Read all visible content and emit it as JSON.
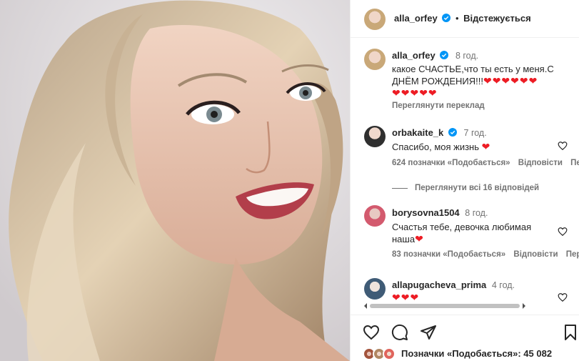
{
  "post_author": {
    "username": "alla_orfey",
    "separator": "•",
    "follow_status": "Відстежується"
  },
  "caption": {
    "username": "alla_orfey",
    "time": "8 год.",
    "text_line1": "какое СЧАСТЬЕ,что ты есть у меня.С",
    "text_line2": "ДНЁМ РОЖДЕНИЯ!!!",
    "hearts_line2": "❤❤❤❤❤❤",
    "hearts_line3": "❤❤❤❤❤",
    "see_translation": "Переглянути переклад"
  },
  "comments": [
    {
      "username": "orbakaite_k",
      "time": "7 год.",
      "text": "Спасибо, моя жизнь",
      "hearts": "❤",
      "likes": "624 позначки «Подобається»",
      "reply": "Відповісти",
      "more": "Пе",
      "view_replies": "Переглянути всі 16 відповідей"
    },
    {
      "username": "borysovna1504",
      "time": "8 год.",
      "text_line1": "Счастья тебе, девочка любимая",
      "text_line2": "наша",
      "hearts": "❤",
      "likes": "83 позначки «Подобається»",
      "reply": "Відповісти",
      "more": "Пер"
    },
    {
      "username": "allapugacheva_prima",
      "time": "4 год.",
      "hearts": "❤❤❤"
    }
  ],
  "footer": {
    "likes_text": "Позначки «Подобається»: 45 082"
  },
  "colors": {
    "verified": "#0095f6",
    "heart": "#ed1c24",
    "text": "#262626",
    "muted": "#737373"
  },
  "icons": [
    "verified-icon",
    "heart-outline-icon",
    "comment-icon",
    "share-icon",
    "bookmark-icon"
  ]
}
